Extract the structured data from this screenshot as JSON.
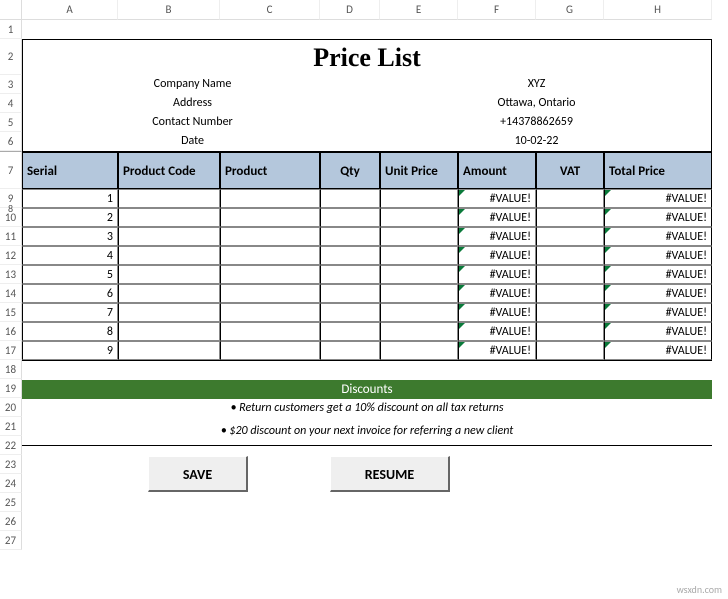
{
  "columns": [
    "A",
    "B",
    "C",
    "D",
    "E",
    "F",
    "G",
    "H"
  ],
  "rownumbers": [
    "1",
    "2",
    "3",
    "4",
    "5",
    "6",
    "7",
    "8",
    "9",
    "10",
    "11",
    "12",
    "13",
    "14",
    "15",
    "16",
    "17",
    "18",
    "19",
    "20",
    "21",
    "22",
    "23",
    "24",
    "25",
    "26",
    "27"
  ],
  "title": "Price List",
  "info": {
    "companyLabel": "Company Name",
    "companyValue": "XYZ",
    "addressLabel": "Address",
    "addressValue": "Ottawa, Ontario",
    "contactLabel": "Contact Number",
    "contactValue": "+14378862659",
    "dateLabel": "Date",
    "dateValue": "10-02-22"
  },
  "headers": {
    "serial": "Serial",
    "productCode": "Product Code",
    "product": "Product",
    "qty": "Qty",
    "unitPrice": "Unit Price",
    "amount": "Amount",
    "vat": "VAT",
    "totalPrice": "Total Price"
  },
  "rows": [
    {
      "serial": "1",
      "amount": "#VALUE!",
      "total": "#VALUE!"
    },
    {
      "serial": "2",
      "amount": "#VALUE!",
      "total": "#VALUE!"
    },
    {
      "serial": "3",
      "amount": "#VALUE!",
      "total": "#VALUE!"
    },
    {
      "serial": "4",
      "amount": "#VALUE!",
      "total": "#VALUE!"
    },
    {
      "serial": "5",
      "amount": "#VALUE!",
      "total": "#VALUE!"
    },
    {
      "serial": "6",
      "amount": "#VALUE!",
      "total": "#VALUE!"
    },
    {
      "serial": "7",
      "amount": "#VALUE!",
      "total": "#VALUE!"
    },
    {
      "serial": "8",
      "amount": "#VALUE!",
      "total": "#VALUE!"
    },
    {
      "serial": "9",
      "amount": "#VALUE!",
      "total": "#VALUE!"
    }
  ],
  "discounts": {
    "header": "Discounts",
    "line1": "• Return customers get a 10% discount on all tax returns",
    "line2": "• $20 discount on your next invoice for referring a new client"
  },
  "buttons": {
    "save": "SAVE",
    "resume": "RESUME"
  },
  "watermark": "wsxdn.com"
}
